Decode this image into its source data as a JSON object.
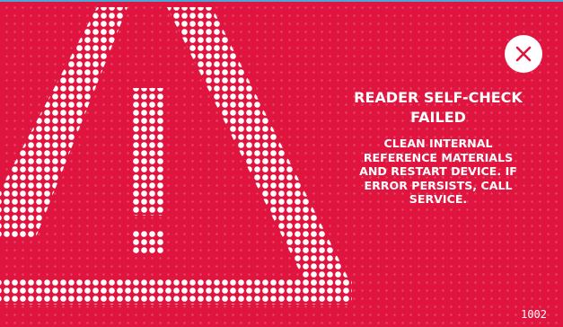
{
  "screen": {
    "title": "READER SELF-CHECK FAILED",
    "message": "CLEAN INTERNAL REFERENCE MATERIALS AND RESTART DEVICE. IF ERROR PERSISTS, CALL SERVICE.",
    "error_code": "1002"
  },
  "icons": {
    "warning": "warning-triangle-icon",
    "close": "close-icon"
  },
  "colors": {
    "background": "#e0153f",
    "foreground": "#ffffff",
    "top_border": "#4aa8d8"
  }
}
